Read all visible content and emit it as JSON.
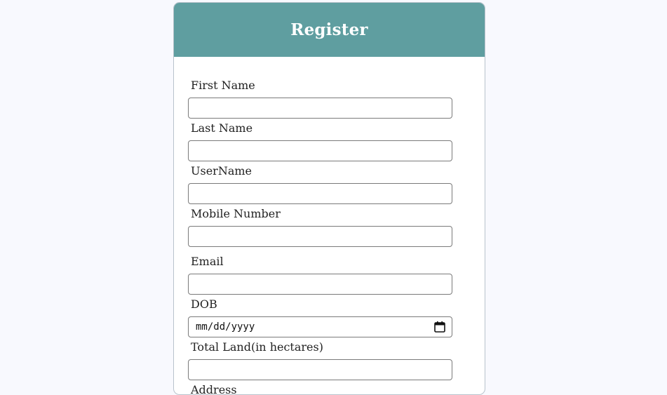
{
  "form": {
    "title": "Register",
    "fields": [
      {
        "label": "First Name",
        "value": "",
        "type": "text"
      },
      {
        "label": "Last Name",
        "value": "",
        "type": "text"
      },
      {
        "label": "UserName",
        "value": "",
        "type": "text"
      },
      {
        "label": "Mobile Number",
        "value": "",
        "type": "tel"
      },
      {
        "label": "Email",
        "value": "",
        "type": "email"
      },
      {
        "label": "DOB",
        "placeholder": "mm/dd/yyyy",
        "type": "date"
      },
      {
        "label": "Total Land(in hectares)",
        "value": "",
        "type": "number"
      },
      {
        "label": "Address",
        "value": "",
        "type": "text"
      }
    ]
  },
  "colors": {
    "header_bg": "#5f9ea0",
    "page_bg": "#f8f9fe",
    "card_border": "#b9c3cc"
  }
}
